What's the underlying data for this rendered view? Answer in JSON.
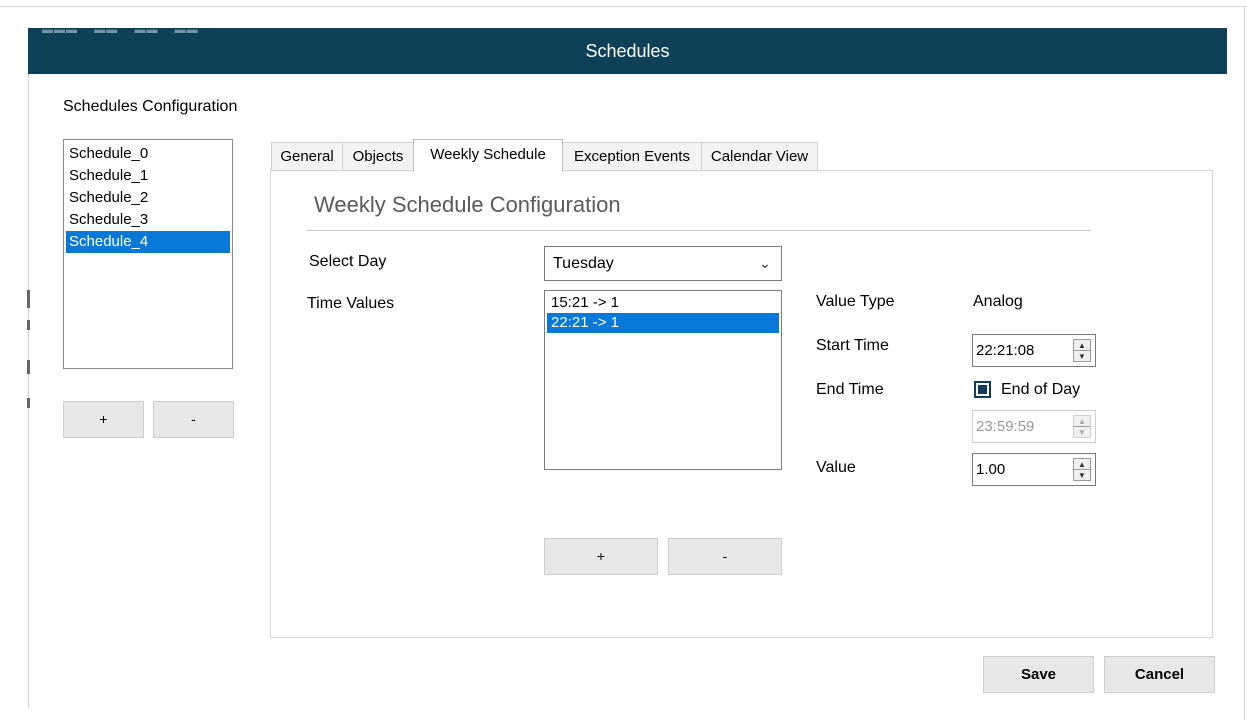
{
  "window": {
    "title": "Schedules"
  },
  "sidebar": {
    "section_label": "Schedules Configuration",
    "schedules": [
      "Schedule_0",
      "Schedule_1",
      "Schedule_2",
      "Schedule_3",
      "Schedule_4"
    ],
    "selected_schedule": "Schedule_4",
    "add_label": "+",
    "remove_label": "-"
  },
  "tabs": [
    {
      "label": "General"
    },
    {
      "label": "Objects"
    },
    {
      "label": "Weekly Schedule"
    },
    {
      "label": "Exception Events"
    },
    {
      "label": "Calendar View"
    }
  ],
  "active_tab": "Weekly Schedule",
  "weekly": {
    "heading": "Weekly Schedule Configuration",
    "select_day_label": "Select Day",
    "selected_day": "Tuesday",
    "time_values_label": "Time Values",
    "time_values": [
      "15:21 -> 1",
      "22:21 -> 1"
    ],
    "selected_time_value": "22:21 -> 1",
    "add_label": "+",
    "remove_label": "-",
    "value_type_label": "Value Type",
    "value_type": "Analog",
    "start_time_label": "Start Time",
    "start_time": "22:21:08",
    "end_time_label": "End Time",
    "end_of_day_label": "End of Day",
    "end_of_day_checked": true,
    "end_time": "23:59:59",
    "value_label": "Value",
    "value": "1.00"
  },
  "footer": {
    "save_label": "Save",
    "cancel_label": "Cancel"
  },
  "colors": {
    "titlebar": "#0e4157",
    "selection": "#0a78d7",
    "checkbox": "#0e3a5e"
  }
}
